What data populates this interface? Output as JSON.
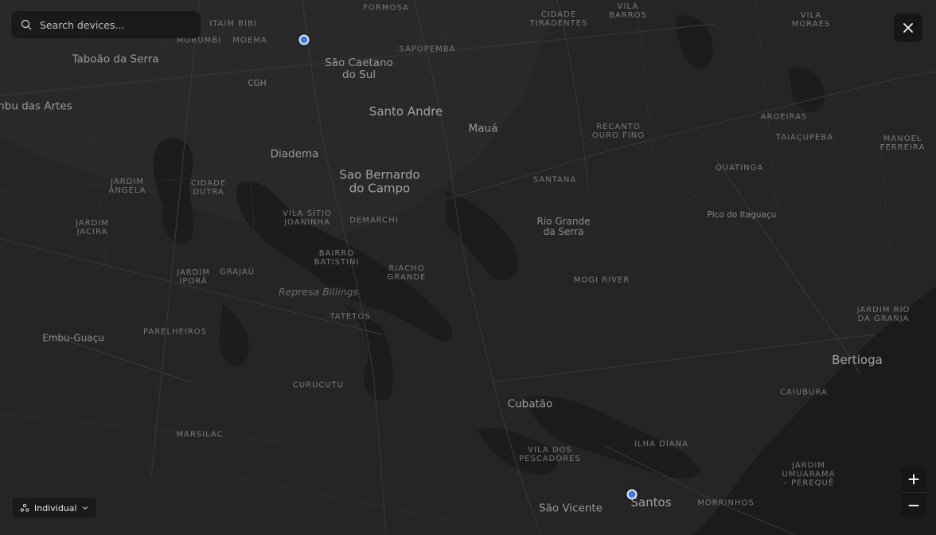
{
  "search": {
    "placeholder": "Search devices..."
  },
  "view_toggle": {
    "label": "Individual"
  },
  "colors": {
    "marker": "#3d7be0",
    "water": "#1c1c1e",
    "land": "#252527",
    "road": "#38383b"
  },
  "map": {
    "labels": [
      {
        "id": "itaim-bibi",
        "text": "ITAIM BIBI",
        "style": "small"
      },
      {
        "id": "formosa",
        "text": "FORMOSA",
        "style": "small"
      },
      {
        "id": "cidade-tiradentes",
        "text": "CIDADE\nTIRADENTES",
        "style": "small"
      },
      {
        "id": "vila-barros",
        "text": "VILA\nBARROS",
        "style": "small"
      },
      {
        "id": "vila-moraes",
        "text": "VILA\nMORAES",
        "style": "small"
      },
      {
        "id": "morumbi",
        "text": "MORUMBI",
        "style": "small"
      },
      {
        "id": "moema",
        "text": "MOEMA",
        "style": "small"
      },
      {
        "id": "sapopemba",
        "text": "SAPOPEMBA",
        "style": "small"
      },
      {
        "id": "taboao",
        "text": "Taboão da Serra",
        "style": "city"
      },
      {
        "id": "sao-caetano",
        "text": "São Caetano\ndo Sul",
        "style": "city"
      },
      {
        "id": "cgh",
        "text": "CGH",
        "style": "poi"
      },
      {
        "id": "embu-artes",
        "text": "nbu das Artes",
        "style": "city"
      },
      {
        "id": "santo-andre",
        "text": "Santo Andre",
        "style": "big"
      },
      {
        "id": "maua",
        "text": "Mauá",
        "style": "city"
      },
      {
        "id": "recanto-ouro-fino",
        "text": "RECANTO\nOURO FINO",
        "style": "small"
      },
      {
        "id": "aroeiras",
        "text": "AROEIRAS",
        "style": "small"
      },
      {
        "id": "taiacupeba",
        "text": "TAIAÇUPEBA",
        "style": "small"
      },
      {
        "id": "manoel-ferreira",
        "text": "MANOEL\nFERREIRA",
        "style": "small"
      },
      {
        "id": "diadema",
        "text": "Diadema",
        "style": "city"
      },
      {
        "id": "sao-bernardo",
        "text": "Sao Bernardo\ndo Campo",
        "style": "big"
      },
      {
        "id": "jardim-angela",
        "text": "JARDIM\nÂNGELA",
        "style": "small"
      },
      {
        "id": "cidade-dutra",
        "text": "CIDADE\nDUTRA",
        "style": "small"
      },
      {
        "id": "santana",
        "text": "SANTANA",
        "style": "small"
      },
      {
        "id": "quatinga",
        "text": "QUATINGA",
        "style": "small"
      },
      {
        "id": "pico-itaguacu",
        "text": "Pico do Itaguaçu",
        "style": "poi"
      },
      {
        "id": "jardim-jacira",
        "text": "JARDIM\nJACIRA",
        "style": "small"
      },
      {
        "id": "vila-sitio-joaninha",
        "text": "VILA SÍTIO\nJOANINHA",
        "style": "small"
      },
      {
        "id": "demarchi",
        "text": "DEMARCHI",
        "style": "small"
      },
      {
        "id": "rio-grande-serra",
        "text": "Rio Grande\nda Serra",
        "style": "town"
      },
      {
        "id": "bairro-batistini",
        "text": "BAIRRO\nBATISTINI",
        "style": "small"
      },
      {
        "id": "jardim-ipora",
        "text": "JARDIM\nIPORÃ",
        "style": "small"
      },
      {
        "id": "grajau",
        "text": "GRAJAÚ",
        "style": "small"
      },
      {
        "id": "riacho-grande",
        "text": "RIACHO\nGRANDE",
        "style": "small"
      },
      {
        "id": "mogi-river",
        "text": "MOGI RIVER",
        "style": "small"
      },
      {
        "id": "represa-billings",
        "text": "Represa Billings",
        "style": "water"
      },
      {
        "id": "jardim-rio-granja",
        "text": "JARDIM RIO\nDA GRANJA",
        "style": "small"
      },
      {
        "id": "tatetos",
        "text": "TATETOS",
        "style": "small"
      },
      {
        "id": "parelheiros",
        "text": "PARELHEIROS",
        "style": "small"
      },
      {
        "id": "embu-guacu",
        "text": "Embu-Guaçu",
        "style": "town"
      },
      {
        "id": "bertioga",
        "text": "Bertioga",
        "style": "big"
      },
      {
        "id": "curucutu",
        "text": "CURUCUTU",
        "style": "small"
      },
      {
        "id": "caiubura",
        "text": "CAIUBURA",
        "style": "small"
      },
      {
        "id": "cubatao",
        "text": "Cubatão",
        "style": "city"
      },
      {
        "id": "marsilac",
        "text": "MARSILAC",
        "style": "small"
      },
      {
        "id": "ilha-diana",
        "text": "ILHA DIANA",
        "style": "small"
      },
      {
        "id": "vila-pescadores",
        "text": "VILA DOS\nPESCADORES",
        "style": "small"
      },
      {
        "id": "jardim-umuarama",
        "text": "JARDIM\nUMUARAMA\n– PEREQUÊ",
        "style": "small"
      },
      {
        "id": "santos",
        "text": "Santos",
        "style": "big"
      },
      {
        "id": "morrinhos",
        "text": "MORRINHOS",
        "style": "small"
      },
      {
        "id": "sao-vicente",
        "text": "São Vicente",
        "style": "city"
      }
    ]
  }
}
